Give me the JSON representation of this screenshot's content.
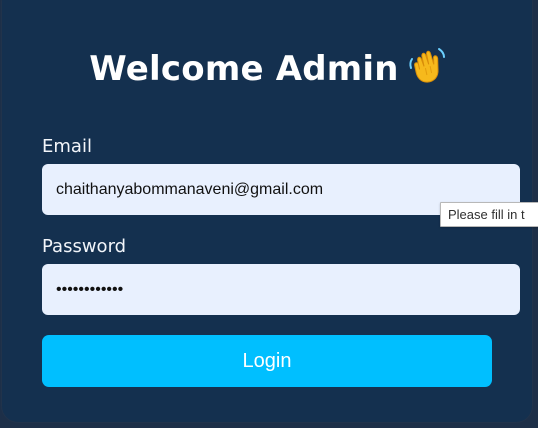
{
  "card": {
    "title": "Welcome Admin",
    "emoji": "waving-hand-icon"
  },
  "form": {
    "email_label": "Email",
    "email_value": "chaithanyabommanaveni@gmail.com",
    "password_label": "Password",
    "password_value": "••••••••••••",
    "login_label": "Login"
  },
  "tooltip": {
    "text": "Please fill in t"
  },
  "colors": {
    "background": "#1d2f48",
    "card": "#14304f",
    "field": "#e8f0fe",
    "button": "#00bfff"
  }
}
